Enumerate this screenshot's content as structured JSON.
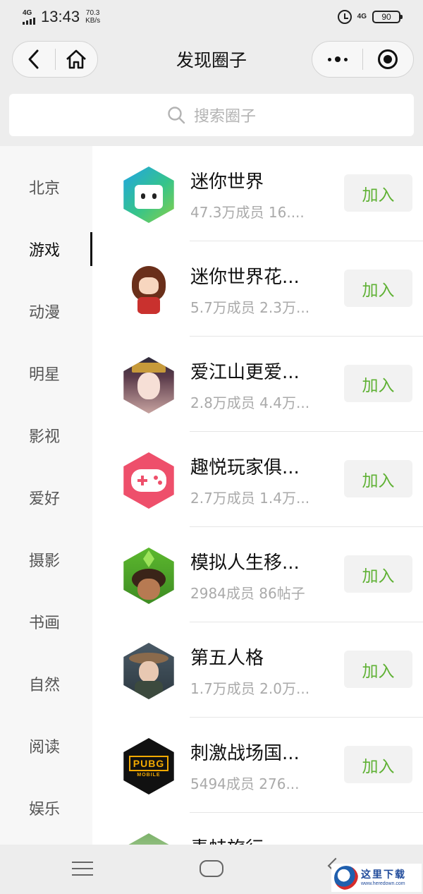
{
  "status_bar": {
    "network_type": "4G",
    "time": "13:43",
    "speed_value": "70.3",
    "speed_unit": "KB/s",
    "network_type_right": "4G",
    "battery": "90"
  },
  "nav": {
    "title": "发现圈子"
  },
  "search": {
    "placeholder": "搜索圈子"
  },
  "sidebar": {
    "items": [
      {
        "label": "北京"
      },
      {
        "label": "游戏"
      },
      {
        "label": "动漫"
      },
      {
        "label": "明星"
      },
      {
        "label": "影视"
      },
      {
        "label": "爱好"
      },
      {
        "label": "摄影"
      },
      {
        "label": "书画"
      },
      {
        "label": "自然"
      },
      {
        "label": "阅读"
      },
      {
        "label": "娱乐"
      }
    ],
    "active_index": 1
  },
  "circles": [
    {
      "title": "迷你世界",
      "members": "47.3万成员",
      "posts": "16....",
      "join": "加入",
      "avatar_icon": "mini-world-avatar-icon"
    },
    {
      "title": "迷你世界花...",
      "members": "5.7万成员",
      "posts": "2.3万...",
      "join": "加入",
      "avatar_icon": "anime-girl-avatar-icon"
    },
    {
      "title": "爱江山更爱...",
      "members": "2.8万成员",
      "posts": "4.4万...",
      "join": "加入",
      "avatar_icon": "costume-lady-avatar-icon"
    },
    {
      "title": "趣悦玩家俱...",
      "members": "2.7万成员",
      "posts": "1.4万...",
      "join": "加入",
      "avatar_icon": "gamepad-avatar-icon"
    },
    {
      "title": "模拟人生移...",
      "members": "2984成员",
      "posts": "86帖子",
      "join": "加入",
      "avatar_icon": "sims-avatar-icon"
    },
    {
      "title": "第五人格",
      "members": "1.7万成员",
      "posts": "2.0万...",
      "join": "加入",
      "avatar_icon": "identity-v-avatar-icon"
    },
    {
      "title": "刺激战场国...",
      "members": "5494成员",
      "posts": "276...",
      "join": "加入",
      "avatar_icon": "pubg-avatar-icon"
    },
    {
      "title": "青蛙旅行",
      "members": "",
      "posts": "",
      "join": "",
      "avatar_icon": "frog-avatar-icon"
    }
  ],
  "pubg_logo": {
    "main": "PUBG",
    "sub": "MOBILE"
  },
  "watermark": {
    "cn": "这里下载",
    "url": "www.heredown.com"
  },
  "colors": {
    "join_text": "#5fb134",
    "background": "#ededed",
    "gamepad": "#ee4f6b"
  }
}
